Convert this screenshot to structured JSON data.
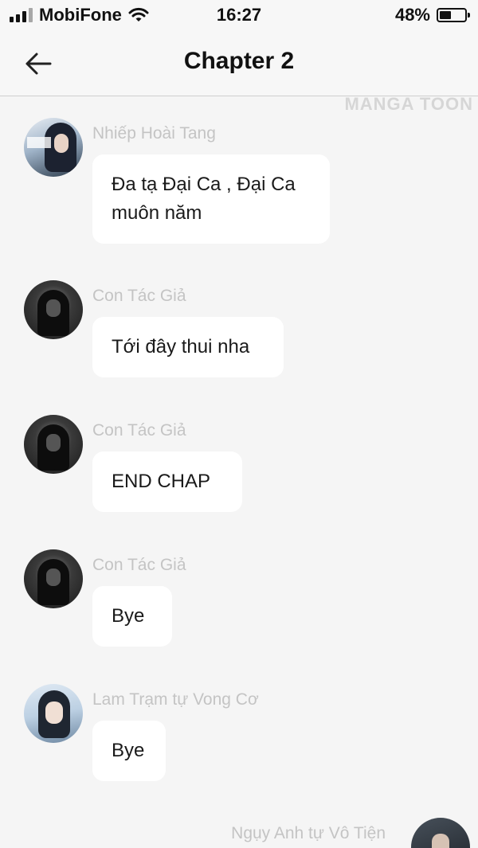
{
  "status_bar": {
    "carrier": "MobiFone",
    "time": "16:27",
    "battery_percent": "48%",
    "battery_level": 0.48
  },
  "nav": {
    "back_icon": "arrow-left-icon",
    "title": "Chapter 2"
  },
  "watermark": "MANGA TOON",
  "messages": [
    {
      "sender": "Nhiếp Hoài Tang",
      "avatar": "nhiep-avatar",
      "text": "Đa tạ Đại Ca , Đại Ca muôn năm"
    },
    {
      "sender": "Con Tác Giả",
      "avatar": "author-avatar",
      "text": "Tới đây thui nha"
    },
    {
      "sender": "Con Tác Giả",
      "avatar": "author-avatar",
      "text": "END CHAP"
    },
    {
      "sender": "Con Tác Giả",
      "avatar": "author-avatar",
      "text": "Bye"
    },
    {
      "sender": "Lam Trạm tự Vong Cơ",
      "avatar": "lam-avatar",
      "text": "Bye"
    },
    {
      "sender": "Ngụy Anh tự Vô Tiện",
      "avatar": "wei-avatar",
      "text": ""
    }
  ]
}
